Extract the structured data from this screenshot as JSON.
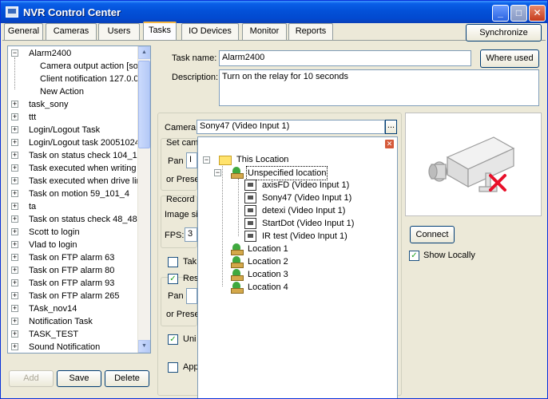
{
  "window": {
    "title": "NVR Control Center",
    "minimize": "_",
    "maximize": "□",
    "close": "✕"
  },
  "tabs": [
    "General",
    "Cameras",
    "Users",
    "Tasks",
    "IO Devices",
    "Monitor",
    "Reports"
  ],
  "active_tab": "Tasks",
  "synchronize_label": "Synchronize",
  "tree": {
    "items": [
      {
        "label": "Alarm2400",
        "expanded": true
      },
      {
        "label": "Camera output action [sor",
        "child": true
      },
      {
        "label": "Client notification 127.0.0.",
        "child": true
      },
      {
        "label": "New Action",
        "child": true
      },
      {
        "label": "task_sony"
      },
      {
        "label": "ttt"
      },
      {
        "label": "Login/Logout Task"
      },
      {
        "label": "Login/Logout task 200510241"
      },
      {
        "label": "Task on status check 104_10"
      },
      {
        "label": "Task executed when writing e"
      },
      {
        "label": "Task executed when drive lim"
      },
      {
        "label": "Task on motion 59_101_4"
      },
      {
        "label": "ta"
      },
      {
        "label": "Task on status check 48_48"
      },
      {
        "label": "Scott to login"
      },
      {
        "label": "Vlad to login"
      },
      {
        "label": "Task on FTP alarm 63"
      },
      {
        "label": "Task on FTP alarm 80"
      },
      {
        "label": "Task on FTP alarm 93"
      },
      {
        "label": "Task on FTP alarm 265"
      },
      {
        "label": "TAsk_nov14"
      },
      {
        "label": "Notification Task"
      },
      {
        "label": "TASK_TEST"
      },
      {
        "label": "Sound Notification"
      }
    ]
  },
  "tree_buttons": {
    "add": "Add",
    "save": "Save",
    "delete": "Delete"
  },
  "form": {
    "task_name_label": "Task name:",
    "task_name_value": "Alarm2400",
    "where_used_label": "Where used",
    "description_label": "Description:",
    "description_value": "Turn on the relay for 10 seconds",
    "camera_label": "Camera",
    "camera_value": "Sony47 (Video Input 1)",
    "camera_browse": "...",
    "set_cam_label": "Set cam",
    "pan_label": "Pan",
    "pan_value": "I",
    "or_preset_label": "or Prese",
    "record_label": "Record",
    "image_size_label": "Image siz",
    "fps_label": "FPS:",
    "fps_value": "3",
    "take_label": "Tak",
    "res_label": "Res",
    "pan2_label": "Pan",
    "or_preset2_label": "or Prese",
    "uni_label": "Uni",
    "app_label": "App",
    "connect_label": "Connect",
    "show_locally_label": "Show Locally"
  },
  "popup": {
    "close": "✕",
    "root": "This Location",
    "unspecified": "Unspecified location",
    "cameras": [
      "axisFD (Video Input 1)",
      "Sony47 (Video Input 1)",
      "detexi (Video Input 1)",
      "StartDot (Video Input 1)",
      "IR test (Video Input 1)"
    ],
    "locations": [
      "Location 1",
      "Location 2",
      "Location 3",
      "Location 4"
    ]
  },
  "colors": {
    "accent": "#0a5fe8",
    "selection": "#316ac5",
    "error_x": "#e8102a"
  }
}
